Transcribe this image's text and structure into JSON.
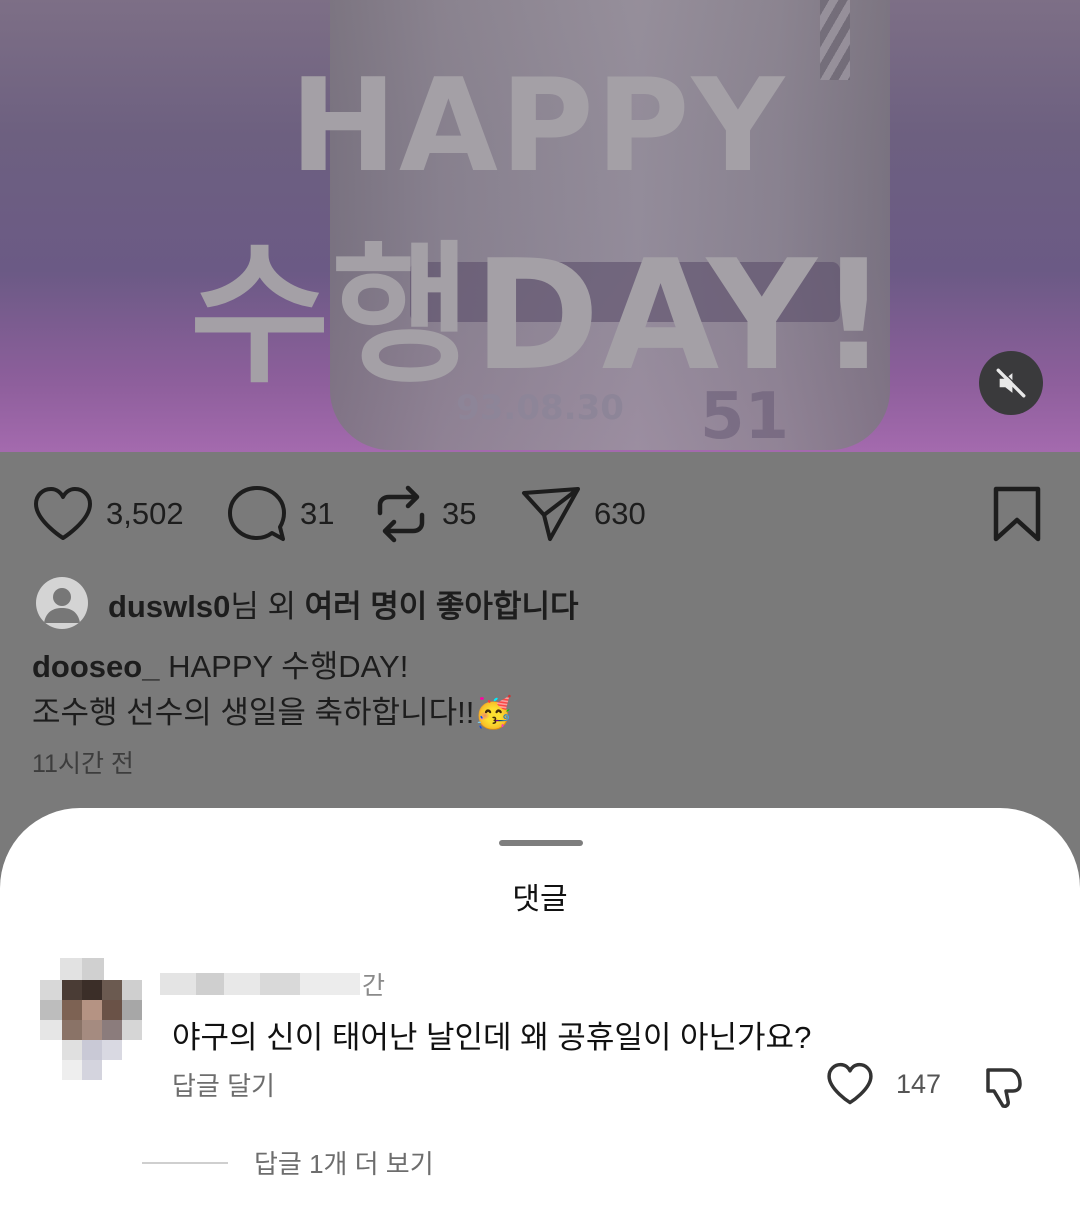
{
  "post": {
    "image_text": {
      "line1": "HAPPY",
      "line2": "수행DAY!",
      "date": "93.08.30",
      "jersey_number": "51"
    },
    "actions": {
      "like_count": "3,502",
      "comment_count": "31",
      "repost_count": "35",
      "share_count": "630"
    },
    "liked_by": {
      "user": "duswls0",
      "suffix_plain": "님 외 ",
      "suffix_bold": "여러 명이 좋아합니다"
    },
    "caption": {
      "username": "dooseo_",
      "line1": "HAPPY 수행DAY!",
      "line2": "조수행 선수의 생일을 축하합니다!!",
      "emoji": "🥳"
    },
    "time": "11시간 전"
  },
  "comments_sheet": {
    "title": "댓글",
    "comment": {
      "time_suffix": "간",
      "text": "야구의 신이 태어난 날인데 왜 공휴일이 아닌가요?",
      "reply_label": "답글 달기",
      "like_count": "147"
    },
    "more_replies": "답글 1개 더 보기"
  }
}
